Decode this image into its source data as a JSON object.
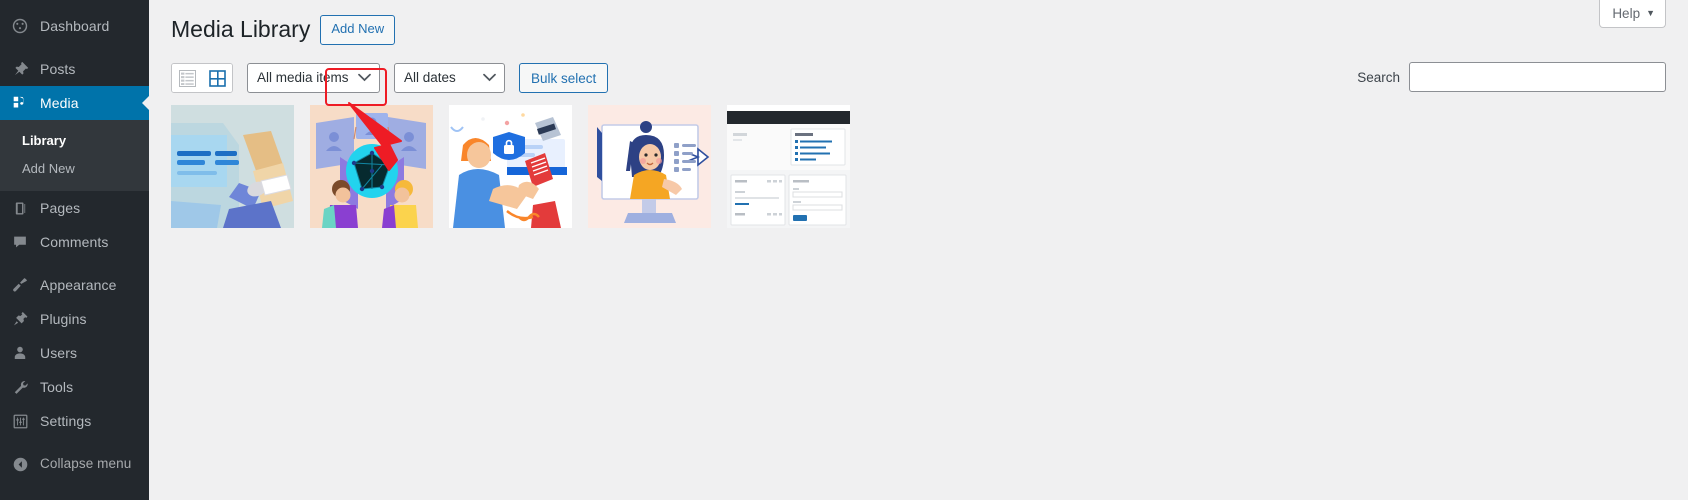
{
  "sidebar": {
    "items": [
      {
        "label": "Dashboard",
        "icon": "dashboard-icon",
        "state": "normal"
      },
      {
        "label": "Posts",
        "icon": "pin-icon",
        "state": "normal"
      },
      {
        "label": "Media",
        "icon": "media-icon",
        "state": "current"
      },
      {
        "label": "Pages",
        "icon": "pages-icon",
        "state": "normal"
      },
      {
        "label": "Comments",
        "icon": "comments-icon",
        "state": "normal"
      },
      {
        "label": "Appearance",
        "icon": "appearance-icon",
        "state": "normal"
      },
      {
        "label": "Plugins",
        "icon": "plugins-icon",
        "state": "normal"
      },
      {
        "label": "Users",
        "icon": "users-icon",
        "state": "normal"
      },
      {
        "label": "Tools",
        "icon": "tools-icon",
        "state": "normal"
      },
      {
        "label": "Settings",
        "icon": "settings-icon",
        "state": "normal"
      }
    ],
    "submenu": [
      {
        "label": "Library",
        "active": true
      },
      {
        "label": "Add New",
        "active": false
      }
    ],
    "collapse": {
      "label": "Collapse menu",
      "icon": "collapse-left-arrow-icon"
    },
    "colors": {
      "background": "#23282d",
      "submenu_background": "#32373c",
      "current_highlight": "#0073aa",
      "text": "#b4b9be",
      "text_active": "#ffffff"
    }
  },
  "header": {
    "help_tab": {
      "label": "Help",
      "caret": "▼"
    },
    "page_title": "Media Library",
    "add_new_label": "Add New"
  },
  "toolbar": {
    "view_switch": {
      "list_view": {
        "name": "list-view",
        "active": false
      },
      "grid_view": {
        "name": "grid-view",
        "active": true
      }
    },
    "media_filter": {
      "value": "All media items",
      "options": [
        "All media items"
      ]
    },
    "date_filter": {
      "value": "All dates",
      "options": [
        "All dates"
      ]
    },
    "bulk_select_label": "Bulk select",
    "search_label": "Search",
    "search_value": "",
    "search_placeholder": ""
  },
  "annotation": {
    "highlight_color": "#ee1c25",
    "target": "view-switch-toggle",
    "arrow": "red-arrow-pointing-up-left"
  },
  "media": {
    "items": [
      {
        "name": "thumbnail-1",
        "alt": "Person seated at a light blue desk workstation illustration",
        "bg": "#cfdee0"
      },
      {
        "name": "thumbnail-2",
        "alt": "Video conference participants around a cyan network globe illustration",
        "bg": "#f7dcc7"
      },
      {
        "name": "thumbnail-3",
        "alt": "Man in blue shirt with security shield lock and card payment illustration",
        "bg": "#ffffff"
      },
      {
        "name": "thumbnail-4",
        "alt": "Woman with dark blue hair in orange top presenting on a monitor illustration",
        "bg": "#fceae4"
      },
      {
        "name": "thumbnail-5",
        "alt": "Screenshot of an admin dashboard page with dark header bar",
        "bg": "#ffffff"
      }
    ]
  },
  "colors": {
    "page_background": "#f0f0f1",
    "link_blue": "#2271b1",
    "text_dark": "#1d2327"
  }
}
